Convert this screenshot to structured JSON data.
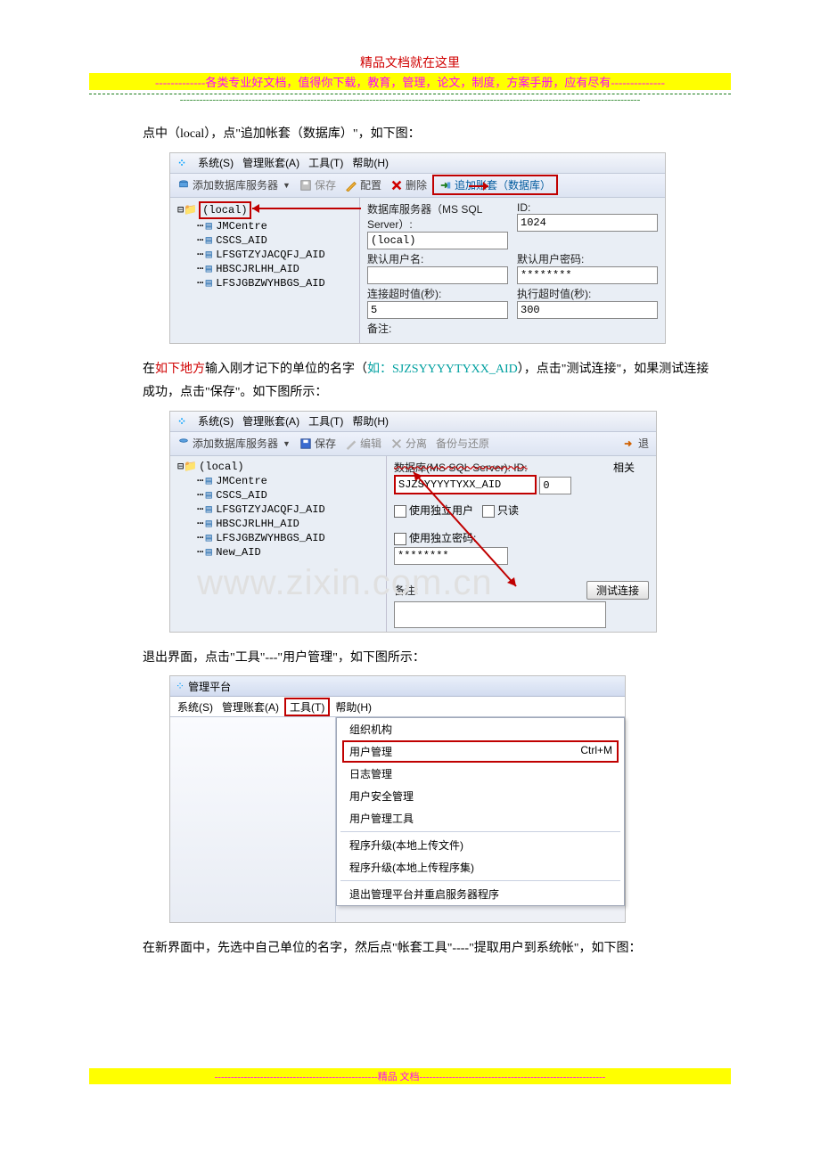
{
  "header": {
    "title": "精品文档就在这里",
    "subtitle": "-------------各类专业好文档，值得你下载，教育，管理，论文，制度，方案手册，应有尽有--------------"
  },
  "para1": {
    "pre": "点中（local），点\"追加帐套（数据库）\"，如下图："
  },
  "shot1": {
    "menubar": {
      "system": "系统(S)",
      "accounts": "管理账套(A)",
      "tools": "工具(T)",
      "help": "帮助(H)"
    },
    "toolbar": {
      "addServer": "添加数据库服务器",
      "save": "保存",
      "config": "配置",
      "delete": "删除",
      "append": "追加账套（数据库）"
    },
    "tree": {
      "root": "(local)",
      "items": [
        "JMCentre",
        "CSCS_AID",
        "LFSGTZYJACQFJ_AID",
        "HBSCJRLHH_AID",
        "LFSJGBZWYHBGS_AID"
      ]
    },
    "form": {
      "serverLabel": "数据库服务器（MS SQL Server）:",
      "idLabel": "ID:",
      "serverVal": "(local)",
      "idVal": "1024",
      "userLabel": "默认用户名:",
      "pwdLabel": "默认用户密码:",
      "pwdVal": "********",
      "connTimeoutLabel": "连接超时值(秒):",
      "connTimeoutVal": "5",
      "execTimeoutLabel": "执行超时值(秒):",
      "execTimeoutVal": "300",
      "remarkLabel": "备注:"
    }
  },
  "para2": {
    "pre": "在",
    "red1": "如下地方",
    "mid1": "输入刚才记下的单位的名字（",
    "cyan": "如：SJZSYYYYTYXX_AID",
    "mid2": "），点击\"测试连接\"，如果测试连接成功，点击\"保存\"。如下图所示："
  },
  "shot2": {
    "menubar": {
      "system": "系统(S)",
      "accounts": "管理账套(A)",
      "tools": "工具(T)",
      "help": "帮助(H)"
    },
    "toolbar": {
      "addServer": "添加数据库服务器",
      "save": "保存",
      "edit": "编辑",
      "detach": "分离",
      "backup": "备份与还原",
      "exit": "退"
    },
    "tree": {
      "root": "(local)",
      "items": [
        "JMCentre",
        "CSCS_AID",
        "LFSGTZYJACQFJ_AID",
        "HBSCJRLHH_AID",
        "LFSJGBZWYHBGS_AID",
        "New_AID"
      ]
    },
    "form": {
      "dbLabel": "数据库(MS SQL Server): ID:",
      "dbVal": "SJZSYYYYTYXX_AID",
      "idVal": "0",
      "indepUser": "使用独立用户",
      "readonly": "只读",
      "indepPwd": "使用独立密码:",
      "pwdVal": "********",
      "remarkLabel": "备注:",
      "testBtn": "测试连接",
      "related": "相关"
    },
    "watermark": "www.zixin.com.cn"
  },
  "para3": "退出界面，点击\"工具\"---\"用户管理\"，如下图所示：",
  "shot3": {
    "title": "管理平台",
    "menubar": {
      "system": "系统(S)",
      "accounts": "管理账套(A)",
      "tools": "工具(T)",
      "help": "帮助(H)"
    },
    "menu": {
      "org": "组织机构",
      "userMgmt": "用户管理",
      "userMgmtShortcut": "Ctrl+M",
      "log": "日志管理",
      "security": "用户安全管理",
      "userTool": "用户管理工具",
      "upgradeFile": "程序升级(本地上传文件)",
      "upgradeSet": "程序升级(本地上传程序集)",
      "exitRestart": "退出管理平台并重启服务器程序"
    }
  },
  "para4": "在新界面中，先选中自己单位的名字，然后点\"帐套工具\"----\"提取用户到系统帐\"，如下图：",
  "footer": "--------------------------------------------------精品 文档---------------------------------------------------------"
}
